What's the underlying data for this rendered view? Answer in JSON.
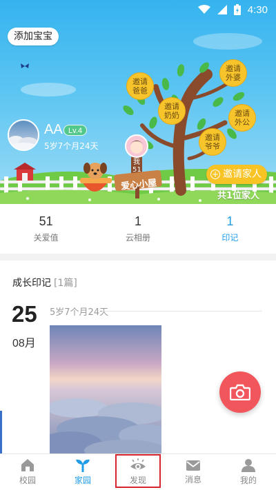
{
  "status_bar": {
    "time": "4:30"
  },
  "hero": {
    "add_baby_label": "添加宝宝",
    "baby": {
      "name": "AA",
      "level": "Lv.4",
      "age": "5岁7个月24天"
    },
    "me_label": "我51",
    "house_sign": "爱心小屋",
    "family_fruits": [
      {
        "label": "邀请爸爸"
      },
      {
        "label": "邀请奶奶"
      },
      {
        "label": "邀请外婆"
      },
      {
        "label": "邀请外公"
      },
      {
        "label": "邀请爷爷"
      }
    ],
    "invite_button_label": "邀请家人",
    "family_count": "共1位家人"
  },
  "stats": [
    {
      "value": "51",
      "label": "关爱值"
    },
    {
      "value": "1",
      "label": "云相册"
    },
    {
      "value": "1",
      "label": "印记",
      "active": true
    }
  ],
  "growth": {
    "title": "成长印记",
    "count": "[1篇]",
    "entry": {
      "day": "25",
      "month": "08月",
      "age": "5岁7个月24天"
    }
  },
  "bottom_nav": [
    {
      "label": "校园",
      "icon": "school-icon"
    },
    {
      "label": "家园",
      "icon": "sprout-icon",
      "active": true
    },
    {
      "label": "发现",
      "icon": "eye-icon",
      "highlighted": true
    },
    {
      "label": "消息",
      "icon": "mail-icon"
    },
    {
      "label": "我的",
      "icon": "person-icon"
    }
  ],
  "colors": {
    "accent": "#1e9ce8",
    "fab": "#f0565b",
    "fruit": "#f7c52b",
    "level_badge": "#52c98a",
    "highlight_box": "#d4232b"
  }
}
